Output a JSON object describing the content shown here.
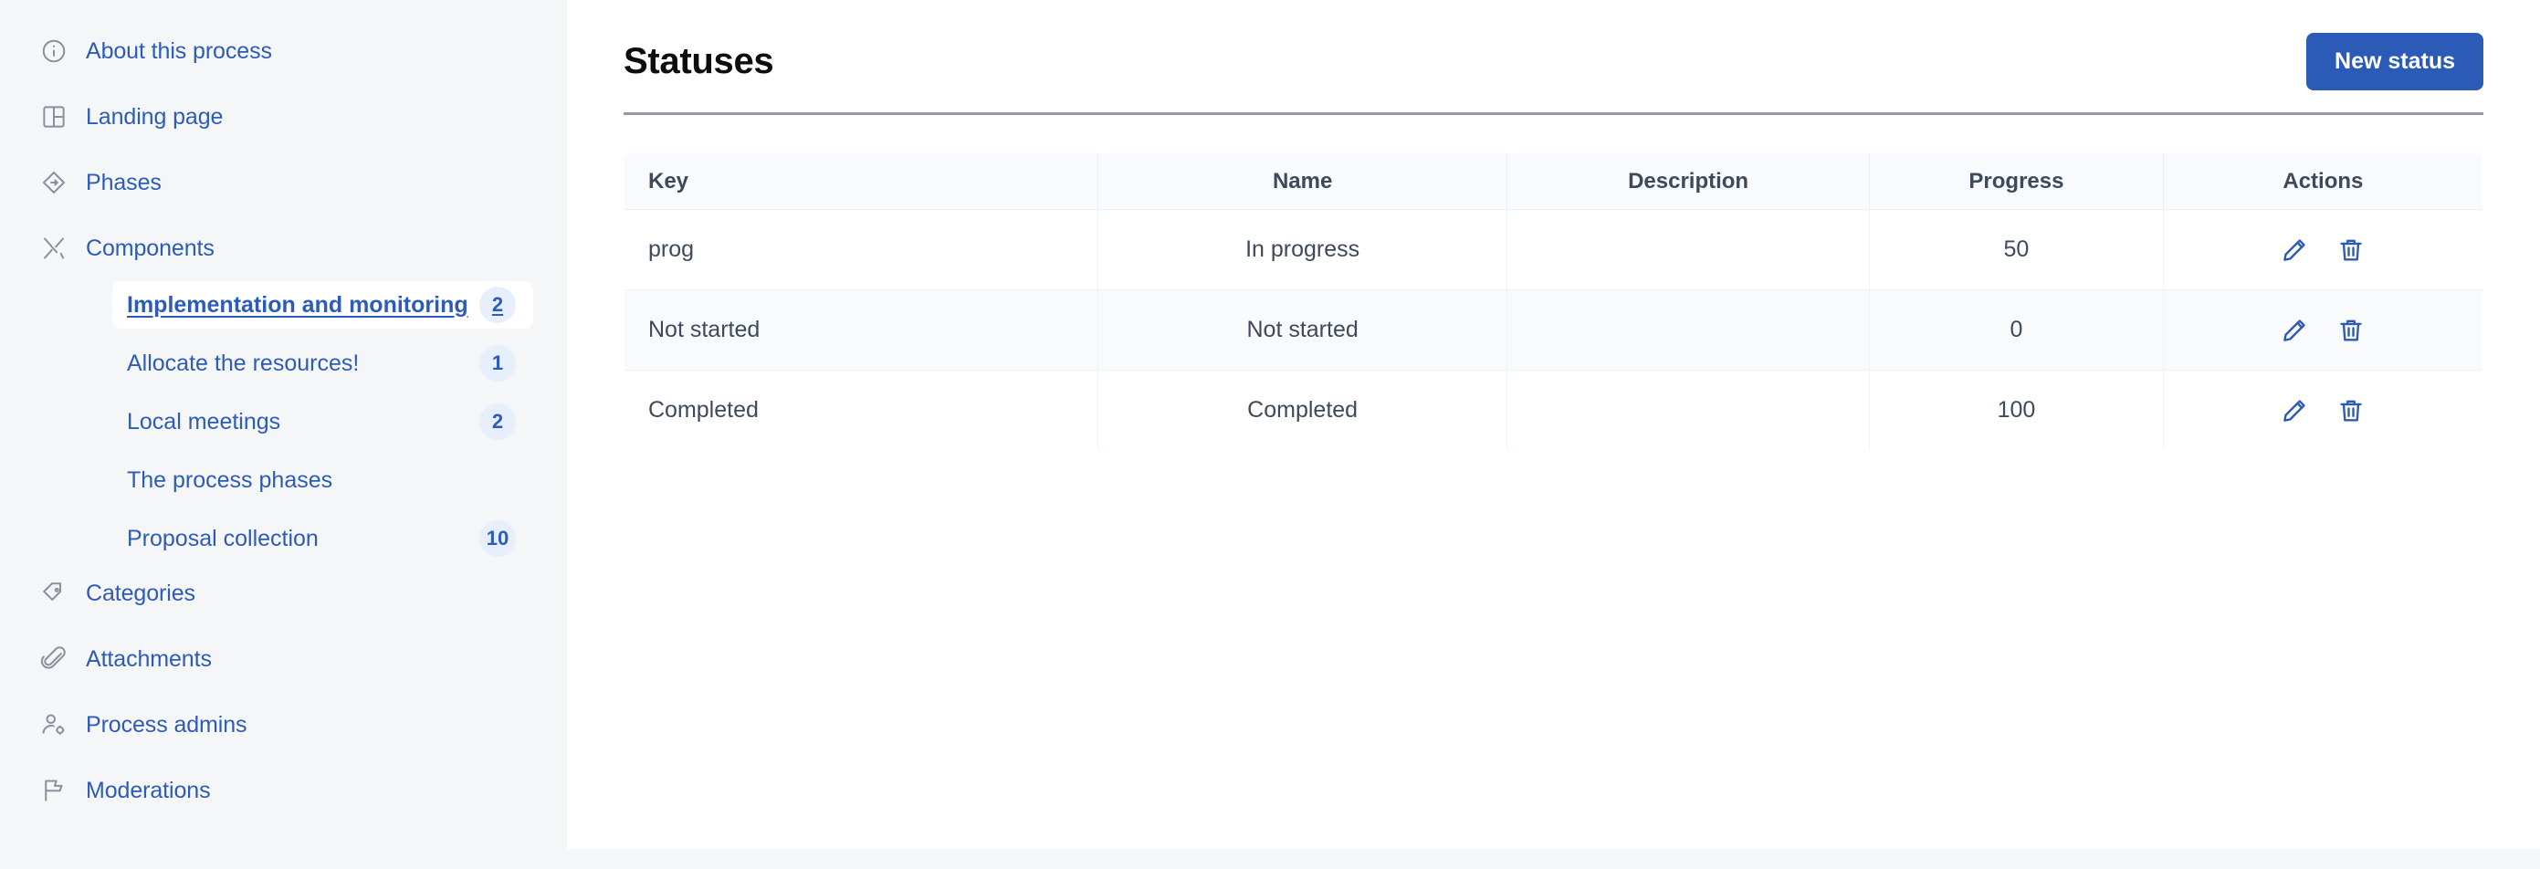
{
  "sidebar": {
    "items": [
      {
        "label": "About this process",
        "icon": "info-circle-icon"
      },
      {
        "label": "Landing page",
        "icon": "layout-grid-icon"
      },
      {
        "label": "Phases",
        "icon": "diamond-arrow-icon"
      },
      {
        "label": "Components",
        "icon": "tools-icon"
      },
      {
        "label": "Categories",
        "icon": "tag-icon"
      },
      {
        "label": "Attachments",
        "icon": "paperclip-icon"
      },
      {
        "label": "Process admins",
        "icon": "user-gear-icon"
      },
      {
        "label": "Moderations",
        "icon": "flag-icon"
      }
    ],
    "components_children": [
      {
        "label": "Implementation and monitoring",
        "badge": "2",
        "active": true
      },
      {
        "label": "Allocate the resources!",
        "badge": "1",
        "active": false
      },
      {
        "label": "Local meetings",
        "badge": "2",
        "active": false
      },
      {
        "label": "The process phases",
        "badge": "",
        "active": false
      },
      {
        "label": "Proposal collection",
        "badge": "10",
        "active": false
      }
    ]
  },
  "main": {
    "title": "Statuses",
    "new_button_label": "New status",
    "table": {
      "headers": [
        "Key",
        "Name",
        "Description",
        "Progress",
        "Actions"
      ],
      "rows": [
        {
          "key": "prog",
          "name": "In progress",
          "description": "",
          "progress": "50"
        },
        {
          "key": "Not started",
          "name": "Not started",
          "description": "",
          "progress": "0"
        },
        {
          "key": "Completed",
          "name": "Completed",
          "description": "",
          "progress": "100"
        }
      ],
      "action_icons": [
        "pencil-icon",
        "trash-icon"
      ]
    }
  },
  "colors": {
    "accent": "#2b5bb7",
    "link": "#2d5bb9",
    "sidebar_bg": "#f5f6f8",
    "badge_bg": "#e7eefc",
    "header_bg": "#f8fafd",
    "text": "#3e4a5c"
  }
}
